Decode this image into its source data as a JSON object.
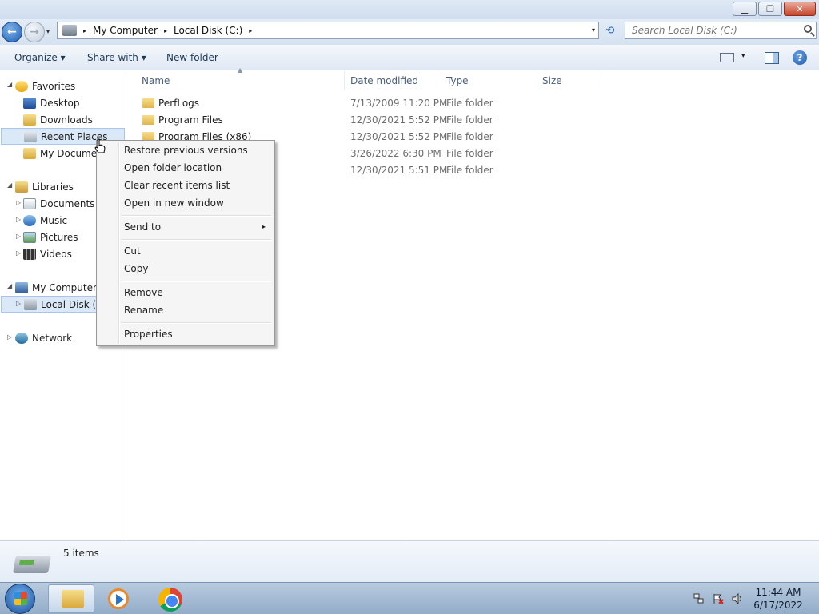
{
  "window": {
    "minimize_glyph": "▁",
    "maximize_glyph": "❐",
    "close_glyph": "✕"
  },
  "address_bar": {
    "breadcrumbs": [
      "My Computer",
      "Local Disk (C:)"
    ],
    "separator_glyph": "▸",
    "dropdown_glyph": "▾",
    "refresh_glyph": "⟲"
  },
  "search": {
    "placeholder": "Search Local Disk (C:)"
  },
  "toolbar": {
    "organize_label": "Organize ▾",
    "share_label": "Share with ▾",
    "new_folder_label": "New folder",
    "view_dropdown_glyph": "▾",
    "help_glyph": "?"
  },
  "nav_pane": {
    "favorites": "Favorites",
    "favorite_items": [
      "Desktop",
      "Downloads",
      "Recent Places",
      "My Documents"
    ],
    "libraries": "Libraries",
    "library_items": [
      "Documents",
      "Music",
      "Pictures",
      "Videos"
    ],
    "computer": "My Computer",
    "computer_items": [
      "Local Disk (C:)"
    ],
    "network": "Network",
    "expanded_glyph": "◢",
    "collapsed_glyph": "▷"
  },
  "columns": [
    "Name",
    "Date modified",
    "Type",
    "Size"
  ],
  "files": [
    {
      "name": "PerfLogs",
      "date": "7/13/2009 11:20 PM",
      "type": "File folder"
    },
    {
      "name": "Program Files",
      "date": "12/30/2021 5:52 PM",
      "type": "File folder"
    },
    {
      "name": "Program Files (x86)",
      "date": "12/30/2021 5:52 PM",
      "type": "File folder"
    },
    {
      "name": "",
      "date": "3/26/2022 6:30 PM",
      "type": "File folder"
    },
    {
      "name": "",
      "date": "12/30/2021 5:51 PM",
      "type": "File folder"
    }
  ],
  "context_menu": {
    "items": [
      "Restore previous versions",
      "Open folder location",
      "Clear recent items list",
      "Open in new window",
      "Send to",
      "Cut",
      "Copy",
      "Remove",
      "Rename",
      "Properties"
    ],
    "submenu_glyph": "▸"
  },
  "status": {
    "items_count": "5 items"
  },
  "clock": {
    "time": "11:44 AM",
    "date": "6/17/2022"
  }
}
